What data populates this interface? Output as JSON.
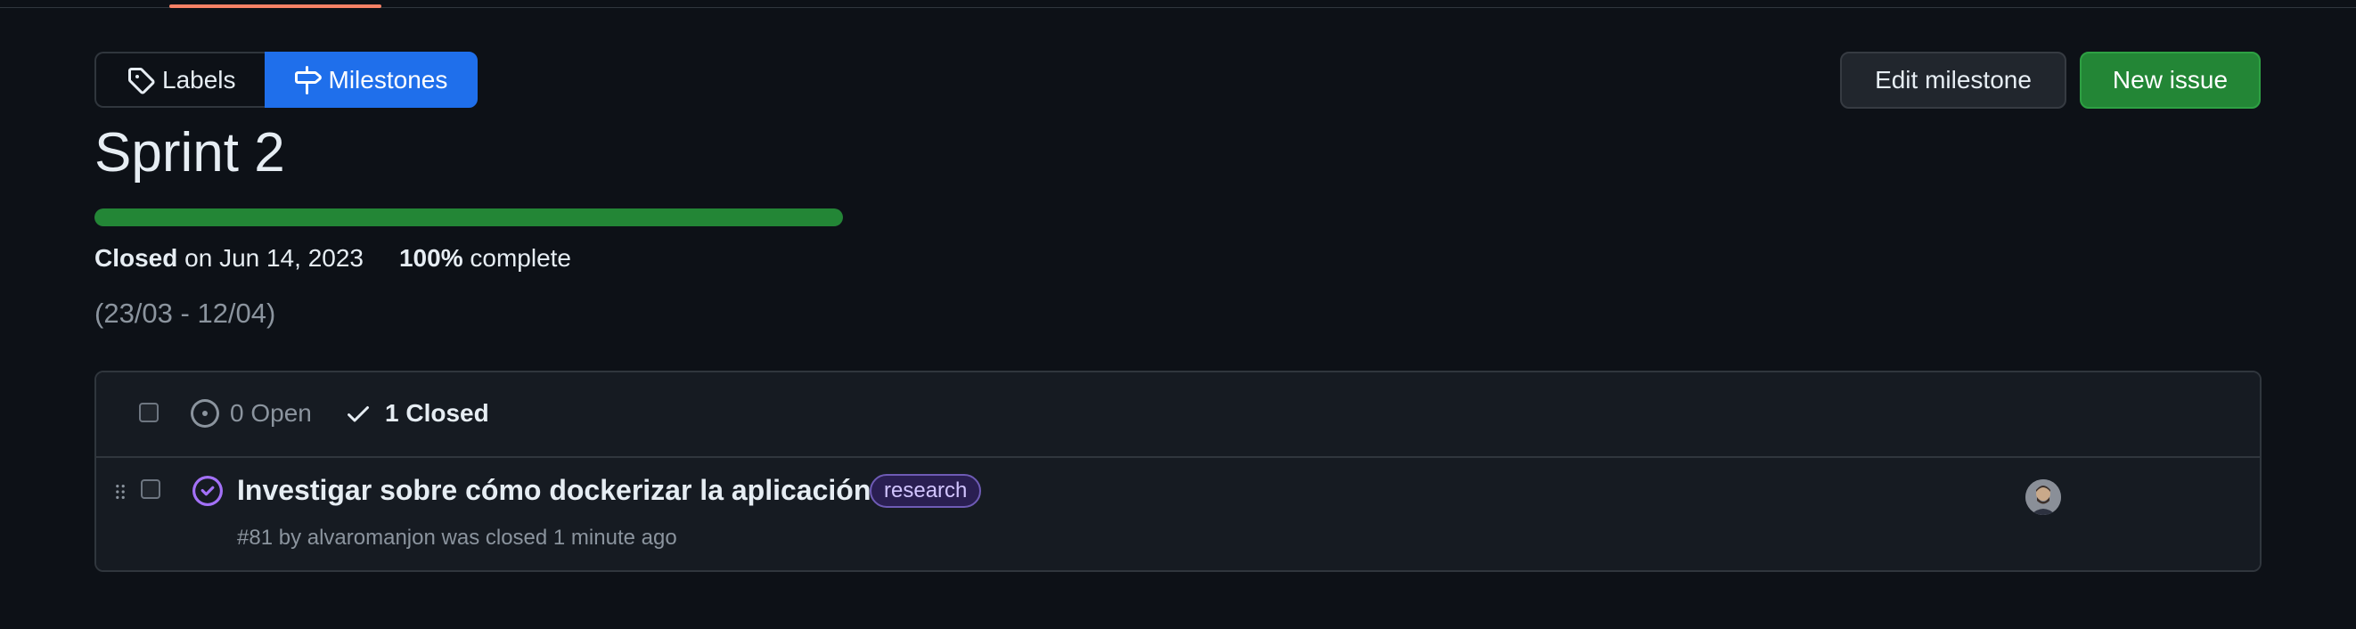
{
  "subnav": {
    "labels_label": "Labels",
    "milestones_label": "Milestones"
  },
  "actions": {
    "edit_label": "Edit milestone",
    "new_issue_label": "New issue"
  },
  "milestone": {
    "title": "Sprint 2",
    "progress_percent": 100,
    "status_word": "Closed",
    "status_date": "on Jun 14, 2023",
    "percent_text": "100%",
    "complete_text": "complete",
    "dates": "(23/03 - 12/04)"
  },
  "issues_header": {
    "open_label": "0 Open",
    "closed_label": "1 Closed"
  },
  "issues": [
    {
      "title": "Investigar sobre cómo dockerizar la aplicación",
      "label": "research",
      "number": "#81",
      "by_text": "by",
      "author": "alvaromanjon",
      "status_text": "was closed 1 minute ago"
    }
  ],
  "colors": {
    "background": "#0d1117",
    "accent_blue": "#1f6feb",
    "success_green": "#238636",
    "closed_purple": "#a371f7"
  },
  "icons": {
    "labels": "tag-icon",
    "milestones": "milestone-icon",
    "open": "issue-open-icon",
    "closed": "check-icon",
    "issue_state": "issue-closed-icon",
    "drag": "grabber-icon"
  }
}
